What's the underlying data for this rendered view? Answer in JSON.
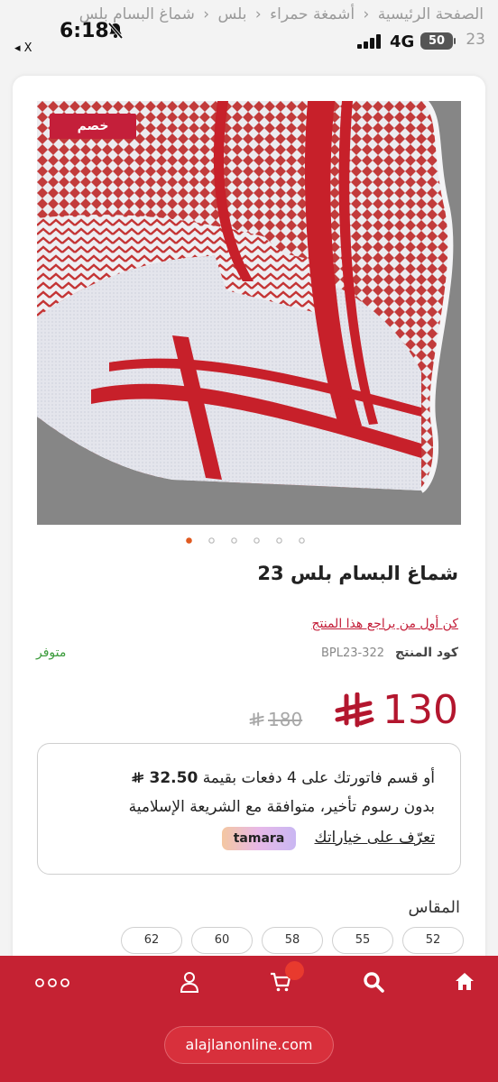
{
  "breadcrumb": {
    "items": [
      "الصفحة الرئيسية",
      "أشمغة حمراء",
      "بلس",
      "شماغ البسام بلس"
    ],
    "separator": "‹",
    "tail": "23"
  },
  "status_bar": {
    "time": "6:18",
    "back_label": "◂ X",
    "network": "4G",
    "battery": "50"
  },
  "product": {
    "badge": "خصم",
    "title": "شماغ البسام بلس 23",
    "review_link": "كن أول من يراجع هذا المنتج",
    "code_label": "كود المنتج",
    "code_value": "BPL23-322",
    "stock": "متوفر",
    "price_now": "130",
    "price_old": "180",
    "image_count": 6,
    "active_image": 0
  },
  "tamara": {
    "line1_prefix": "أو قسم فاتورتك على 4 دفعات بقيمة",
    "line1_amount": "32.50",
    "line2": "بدون رسوم تأخير، متوافقة مع الشريعة الإسلامية",
    "link": "تعرّف على خياراتك",
    "logo_text": "tamara"
  },
  "sizes": {
    "label": "المقاس",
    "options": [
      "52",
      "55",
      "58",
      "60",
      "62"
    ]
  },
  "bottom_nav": {
    "url": "alajlanonline.com",
    "icons": [
      "home-icon",
      "search-icon",
      "cart-icon",
      "user-icon",
      "more-icon"
    ]
  },
  "colors": {
    "brand": "#c52233",
    "price": "#b3162e",
    "in_stock": "#3a9b3a",
    "active_dot": "#e05a20"
  }
}
